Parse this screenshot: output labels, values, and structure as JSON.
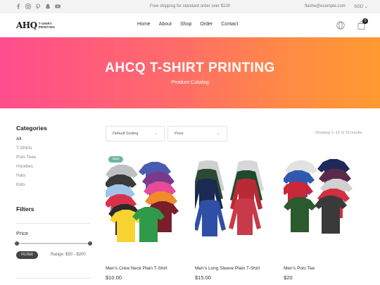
{
  "topbar": {
    "promo": "Free shipping for standard order over $100",
    "email": "flashe@example.com",
    "currency": "SGD",
    "socials": [
      "facebook-icon",
      "instagram-icon",
      "pinterest-icon",
      "snapchat-icon",
      "youtube-icon"
    ]
  },
  "header": {
    "logo_mark": "AHQ",
    "logo_line1": "T-SHIRT",
    "logo_line2": "PRINTING",
    "nav": [
      "Home",
      "About",
      "Shop",
      "Order",
      "Contact"
    ],
    "cart_count": "0"
  },
  "hero": {
    "title": "AHCQ T-SHIRT PRINTING",
    "subtitle": "Product Catalog"
  },
  "sidebar": {
    "categories_title": "Categories",
    "categories": [
      "All",
      "T-Shirts",
      "Polo Tees",
      "Hoodies",
      "Hats",
      "Kids"
    ],
    "filters_title": "Filters",
    "price_title": "Price",
    "filter_button": "FILTER",
    "range_text": "Range: $50 - $200"
  },
  "toolbar": {
    "sort_label": "Default Sorting",
    "price_label": "Price",
    "showing": "Showing 1–12 of 16 results"
  },
  "products": [
    {
      "name": "Men's Crew Neck Plain T-Shirt",
      "price": "$10.00",
      "badge": "New"
    },
    {
      "name": "Men's Long Sleeve Plain T-Shirt",
      "price": "$15.00",
      "badge": ""
    },
    {
      "name": "Men's Polo Tee",
      "price": "$20",
      "badge": ""
    }
  ],
  "colors": {
    "hero_start": "#ff4d8d",
    "hero_end": "#ff9a30",
    "badge": "#6fb3a0"
  }
}
